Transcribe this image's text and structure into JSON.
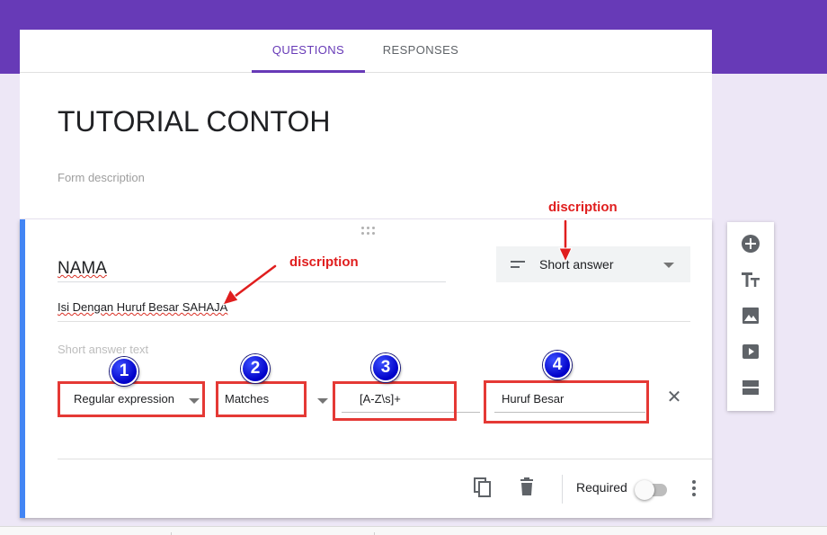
{
  "tabs": [
    {
      "label": "QUESTIONS",
      "active": true
    },
    {
      "label": "RESPONSES",
      "active": false
    }
  ],
  "form": {
    "title": "TUTORIAL CONTOH",
    "description_placeholder": "Form description"
  },
  "question": {
    "title": "NAMA",
    "description": "Isi Dengan Huruf Besar SAHAJA",
    "type": "Short answer",
    "answer_placeholder": "Short answer text",
    "validation": {
      "type": "Regular expression",
      "condition": "Matches",
      "pattern": "[A-Z\\s]+",
      "error_text": "Huruf Besar"
    },
    "required_label": "Required",
    "required": false
  },
  "annotations": {
    "label_1": "discription",
    "label_2": "discription",
    "badges": [
      "1",
      "2",
      "3",
      "4"
    ]
  },
  "icons": {
    "type": "short-text-icon",
    "footer": [
      "duplicate-icon",
      "delete-icon",
      "more-vert-icon"
    ],
    "toolbar": [
      "add-question-icon",
      "add-title-icon",
      "add-image-icon",
      "add-video-icon",
      "add-section-icon"
    ]
  },
  "colors": {
    "brand": "#673ab7",
    "background": "#ede7f6",
    "active_question_border": "#4285f4",
    "annotation_red": "#e01e1e",
    "badge_blue": "#0000c8"
  }
}
